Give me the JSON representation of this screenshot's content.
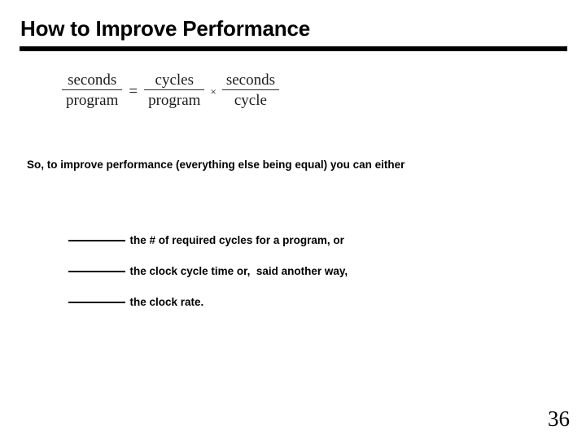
{
  "slide": {
    "title": "How to Improve Performance",
    "page_number": "36"
  },
  "formula": {
    "left": {
      "numerator": "seconds",
      "denominator": "program"
    },
    "equals": "=",
    "middle": {
      "numerator": "cycles",
      "denominator": "program"
    },
    "times": "×",
    "right": {
      "numerator": "seconds",
      "denominator": "cycle"
    }
  },
  "body": {
    "lead": "So, to improve performance (everything else being equal) you can either",
    "bullets": [
      {
        "blank": "________",
        "text": "the # of required cycles for a program, or"
      },
      {
        "blank": "________",
        "text": "the clock cycle time or,  said another way,"
      },
      {
        "blank": "________",
        "text": "the clock rate."
      }
    ]
  }
}
